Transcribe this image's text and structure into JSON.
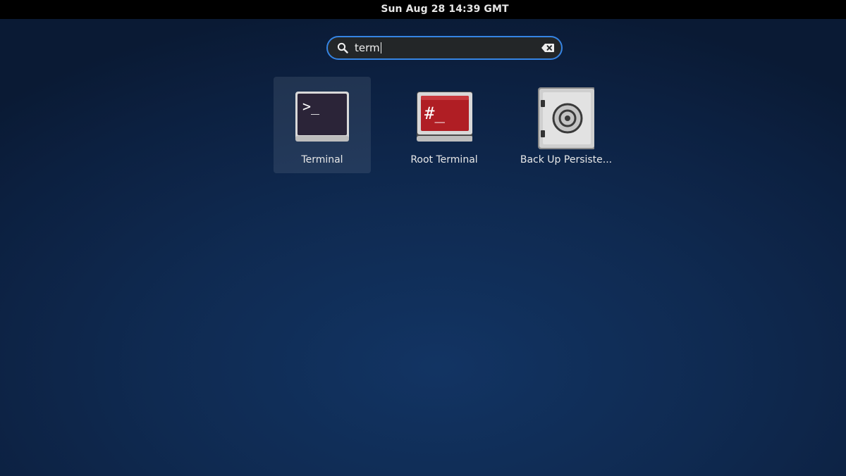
{
  "topbar": {
    "clock": "Sun Aug 28  14:39 GMT"
  },
  "search": {
    "value": "term",
    "accent_color": "#3584e4",
    "icon": "search-icon",
    "clear_icon": "clear-text-icon"
  },
  "results": [
    {
      "label": "Terminal",
      "icon": "terminal-icon",
      "selected": true
    },
    {
      "label": "Root Terminal",
      "icon": "root-terminal-icon",
      "selected": false
    },
    {
      "label": "Back Up Persiste...",
      "icon": "safe-icon",
      "selected": false
    }
  ]
}
